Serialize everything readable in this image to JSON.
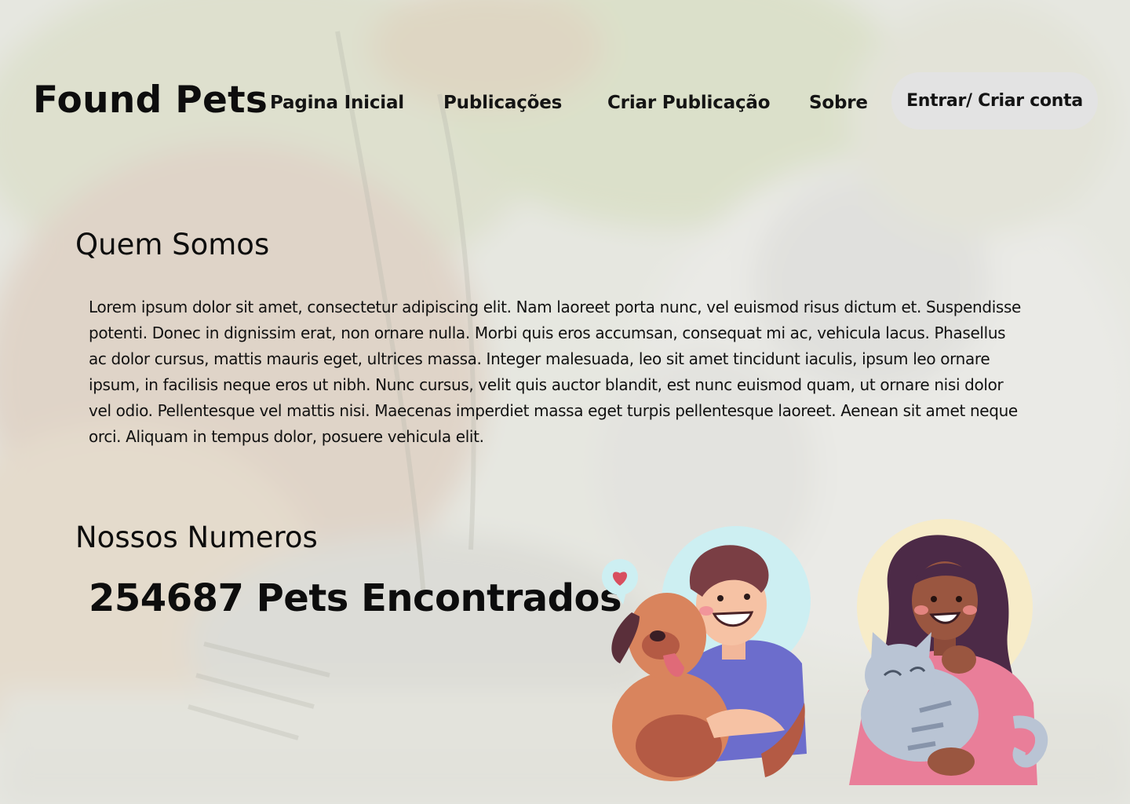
{
  "header": {
    "logo": "Found Pets",
    "nav": {
      "home": "Pagina Inicial",
      "posts": "Publicações",
      "create_post": "Criar Publicação",
      "about": "Sobre"
    },
    "login_button": "Entrar/ Criar conta"
  },
  "about": {
    "title": "Quem Somos",
    "text": "Lorem ipsum dolor sit amet, consectetur adipiscing elit. Nam laoreet porta nunc, vel euismod risus dictum et. Suspendisse potenti. Donec in dignissim erat, non ornare nulla. Morbi quis eros accumsan, consequat mi ac, vehicula lacus. Phasellus ac dolor cursus, mattis mauris eget, ultrices massa. Integer malesuada, leo sit amet tincidunt iaculis, ipsum leo ornare ipsum, in facilisis neque eros ut nibh. Nunc cursus, velit quis auctor blandit, est nunc euismod quam, ut ornare nisi dolor vel odio. Pellentesque vel mattis nisi. Maecenas imperdiet massa eget turpis pellentesque laoreet. Aenean sit amet neque orci. Aliquam in tempus dolor, posuere vehicula elit."
  },
  "numbers": {
    "title": "Nossos Numeros",
    "stat": "254687 Pets Encontrados"
  },
  "illustrations": {
    "man_with_dog": "man-hugging-dog-illustration",
    "woman_with_cat": "woman-hugging-cat-illustration"
  },
  "colors": {
    "background_wash": "#eeeeea",
    "button_bg": "#e3e3e3",
    "text": "#111111"
  }
}
